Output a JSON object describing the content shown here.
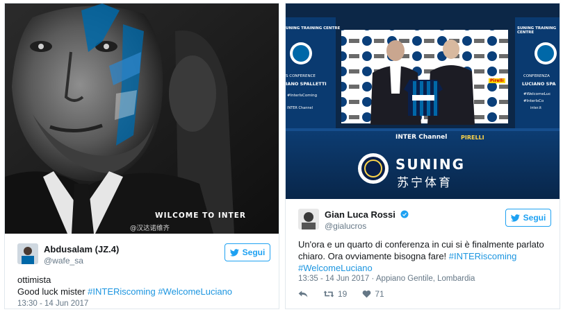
{
  "left_tweet": {
    "image_caption": "WILCOME TO INTER",
    "image_watermark": "@汉达诺维齐",
    "user": {
      "name": "Abdusalam (JZ.4)",
      "handle": "@wafe_sa"
    },
    "follow_label": "Segui",
    "text_line1": "ottimista",
    "text_prefix": "Good luck mister",
    "hashtags": [
      "#INTERiscoming",
      "#WelcomeLuciano"
    ],
    "timestamp": "13:30 - 14 Jun 2017"
  },
  "right_tweet": {
    "photo": {
      "backdrop_left_top": "UNING TRAINING CENTRE",
      "backdrop_left_mid": "S CONFERENCE",
      "backdrop_left_name": "IANO SPALLETTI",
      "backdrop_left_tag": "#InterIsComing",
      "backdrop_left_channel": "INTER Channel",
      "backdrop_right_top": "SUNING TRAINING CENTRE",
      "backdrop_right_mid": "CONFERENZA",
      "backdrop_right_name": "LUCIANO SPA",
      "backdrop_right_tag": "#WelcomeLuc",
      "backdrop_right_tag2": "#InterIsCo",
      "backdrop_right_site": "inter.it",
      "sponsor": "Pirelli",
      "podium_channel": "INTER Channel",
      "podium_pirelli": "PIRELLI",
      "suning_en": "SUNING",
      "suning_cn": "苏宁体育"
    },
    "user": {
      "name": "Gian Luca Rossi",
      "handle": "@gialucros",
      "verified": true
    },
    "follow_label": "Segui",
    "text_line1": "Un'ora e un quarto di conferenza in cui si è finalmente parlato",
    "text_line2": "chiaro. Ora ovviamente bisogna fare!",
    "hashtags": [
      "#INTERiscoming",
      "#WelcomeLuciano"
    ],
    "timestamp_location": "13:35 - 14 Jun 2017 · Appiano Gentile, Lombardia",
    "retweets": "19",
    "likes": "71"
  },
  "colors": {
    "twitter_blue": "#1da1f2",
    "hashtag": "#1b95e0",
    "muted": "#657786",
    "inter_blue": "#0068a8"
  },
  "icons": [
    "bird-icon",
    "verified-badge-icon",
    "reply-icon",
    "retweet-icon",
    "heart-icon"
  ]
}
